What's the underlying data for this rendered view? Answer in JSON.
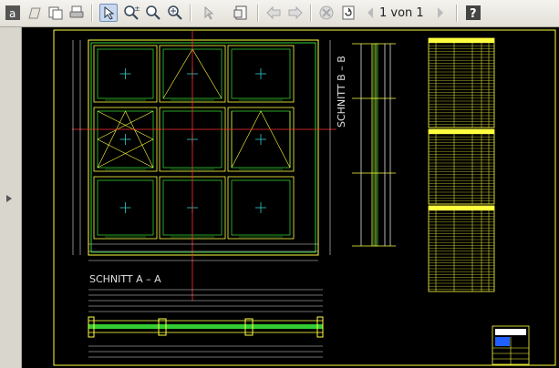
{
  "toolbar": {
    "icons": [
      "app-logo-icon",
      "open-icon",
      "copy-icon",
      "print-icon",
      "select-tool-icon",
      "zoom-in-out-icon",
      "zoom-icon",
      "zoom-window-icon",
      "pointer-icon",
      "page-setup-icon",
      "back-arrow-icon",
      "forward-arrow-icon",
      "stop-icon",
      "refresh-icon",
      "prev-page-icon",
      "next-page-icon",
      "help-icon"
    ],
    "page_current": "1",
    "page_of": "von",
    "page_total": "1",
    "page_label": "1 von 1"
  },
  "drawing": {
    "section_a": "SCHNITT A – A",
    "section_b": "SCHNITT B – B",
    "colors": {
      "frame": "#ffff40",
      "glass": "#33cc33",
      "dim": "#e0e0e0",
      "axis": "#ff3030",
      "cross": "#33cccc",
      "title": "#2060ff"
    }
  }
}
